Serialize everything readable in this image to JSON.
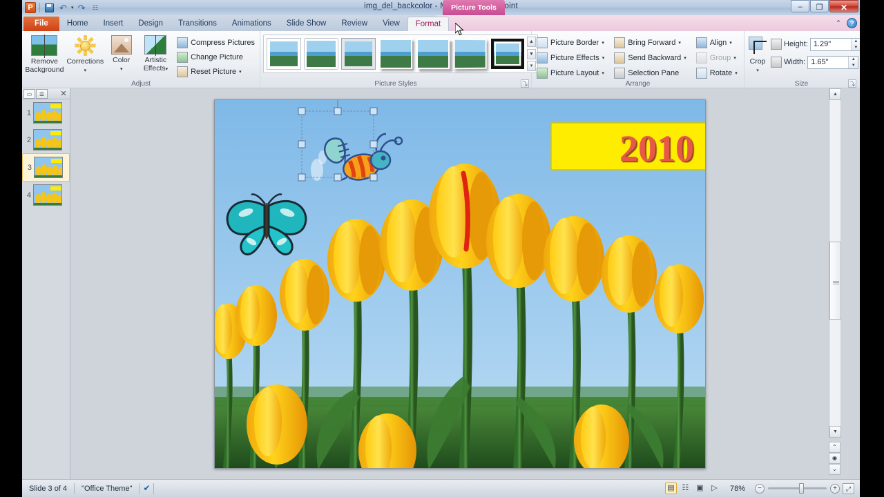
{
  "window": {
    "title": "img_del_backcolor - Microsoft PowerPoint",
    "minimize_label": "–",
    "restore_label": "❐",
    "close_label": "✕",
    "app_logo_label": "P"
  },
  "quick_access": {
    "save_label": "Save",
    "undo_label": "Undo",
    "redo_label": "Redo",
    "customize_label": "Customize Quick Access Toolbar",
    "undo_glyph": "↶",
    "redo_glyph": "↷",
    "caret": "▾",
    "customize_glyph": "☷"
  },
  "ribbon": {
    "contextual_group": "Picture Tools",
    "tabs": [
      {
        "label": "File",
        "active": false
      },
      {
        "label": "Home",
        "active": false
      },
      {
        "label": "Insert",
        "active": false
      },
      {
        "label": "Design",
        "active": false
      },
      {
        "label": "Transitions",
        "active": false
      },
      {
        "label": "Animations",
        "active": false
      },
      {
        "label": "Slide Show",
        "active": false
      },
      {
        "label": "Review",
        "active": false
      },
      {
        "label": "View",
        "active": false
      },
      {
        "label": "Format",
        "active": true
      }
    ],
    "collapse_label": "⌃",
    "help_label": "?",
    "groups": {
      "adjust": {
        "title": "Adjust",
        "remove_background": "Remove\nBackground",
        "remove_background_line1": "Remove",
        "remove_background_line2": "Background",
        "corrections": "Corrections",
        "color": "Color",
        "artistic_effects_line1": "Artistic",
        "artistic_effects_line2": "Effects",
        "compress_pictures": "Compress Pictures",
        "change_picture": "Change Picture",
        "reset_picture": "Reset Picture",
        "caret": "▾"
      },
      "picture_styles": {
        "title": "Picture Styles",
        "scroll_up": "▲",
        "scroll_down": "▼",
        "more": "▾",
        "dialog_launcher": "⤵",
        "selected_index": 6,
        "style_count": 7
      },
      "arrange": {
        "title": "Arrange",
        "picture_border": "Picture Border",
        "picture_effects": "Picture Effects",
        "picture_layout": "Picture Layout",
        "bring_forward": "Bring Forward",
        "send_backward": "Send Backward",
        "selection_pane": "Selection Pane",
        "align": "Align",
        "group": "Group",
        "group_disabled": true,
        "rotate": "Rotate",
        "caret": "▾"
      },
      "size": {
        "title": "Size",
        "crop": "Crop",
        "height_label": "Height:",
        "height_value": "1.29\"",
        "width_label": "Width:",
        "width_value": "1.65\"",
        "spin_up": "▲",
        "spin_down": "▼",
        "dialog_launcher": "⤵",
        "caret": "▾"
      }
    }
  },
  "slide_panel": {
    "tab_slides_label": "Slides",
    "tab_outline_label": "Outline",
    "close_label": "✕",
    "slides": [
      {
        "number": "1",
        "selected": false
      },
      {
        "number": "2",
        "selected": false
      },
      {
        "number": "3",
        "selected": true
      },
      {
        "number": "4",
        "selected": false
      }
    ]
  },
  "slide": {
    "year_textbox": {
      "text": "2010",
      "background": "#ffed00",
      "text_color": "#e8584a",
      "border_color": "#c9c200"
    },
    "selected_object": "bee-clipart",
    "objects": [
      "bee-clipart",
      "butterfly-clipart",
      "year-textbox",
      "tulip-photo-background"
    ],
    "selection": {
      "handle_color": "#b8d7ee",
      "rotate_handle_color": "#7ac143"
    }
  },
  "scroll": {
    "up_arrow": "▲",
    "down_arrow": "▼",
    "previous_slide": "⌃",
    "next_slide": "⌄",
    "all_slides": "◉"
  },
  "status_bar": {
    "slide_indicator": "Slide 3 of 4",
    "theme": "\"Office Theme\"",
    "spellcheck_glyph": "✔",
    "views": [
      {
        "name": "normal",
        "glyph": "▤",
        "selected": true
      },
      {
        "name": "slide-sorter",
        "glyph": "☷",
        "selected": false
      },
      {
        "name": "reading",
        "glyph": "▣",
        "selected": false
      },
      {
        "name": "slide-show",
        "glyph": "▷",
        "selected": false
      }
    ],
    "zoom_level": "78%",
    "zoom_out": "−",
    "zoom_in": "+",
    "fit_to_window": "⤢"
  }
}
